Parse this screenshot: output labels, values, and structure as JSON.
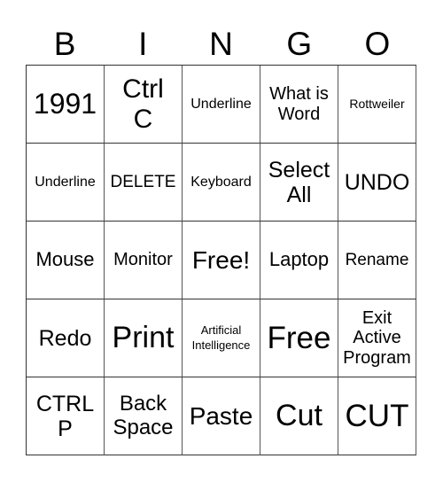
{
  "header": [
    "B",
    "I",
    "N",
    "G",
    "O"
  ],
  "rows": [
    [
      "1991",
      "Ctrl C",
      "Underline",
      "What is Word",
      "Rottweiler"
    ],
    [
      "Underline",
      "DELETE",
      "Keyboard",
      "Select All",
      "UNDO"
    ],
    [
      "Mouse",
      "Monitor",
      "Free!",
      "Laptop",
      "Rename"
    ],
    [
      "Redo",
      "Print",
      "Artificial Intelligence",
      "Free",
      "Exit Active Program"
    ],
    [
      "CTRL P",
      "Back Space",
      "Paste",
      "Cut",
      "CUT"
    ]
  ]
}
